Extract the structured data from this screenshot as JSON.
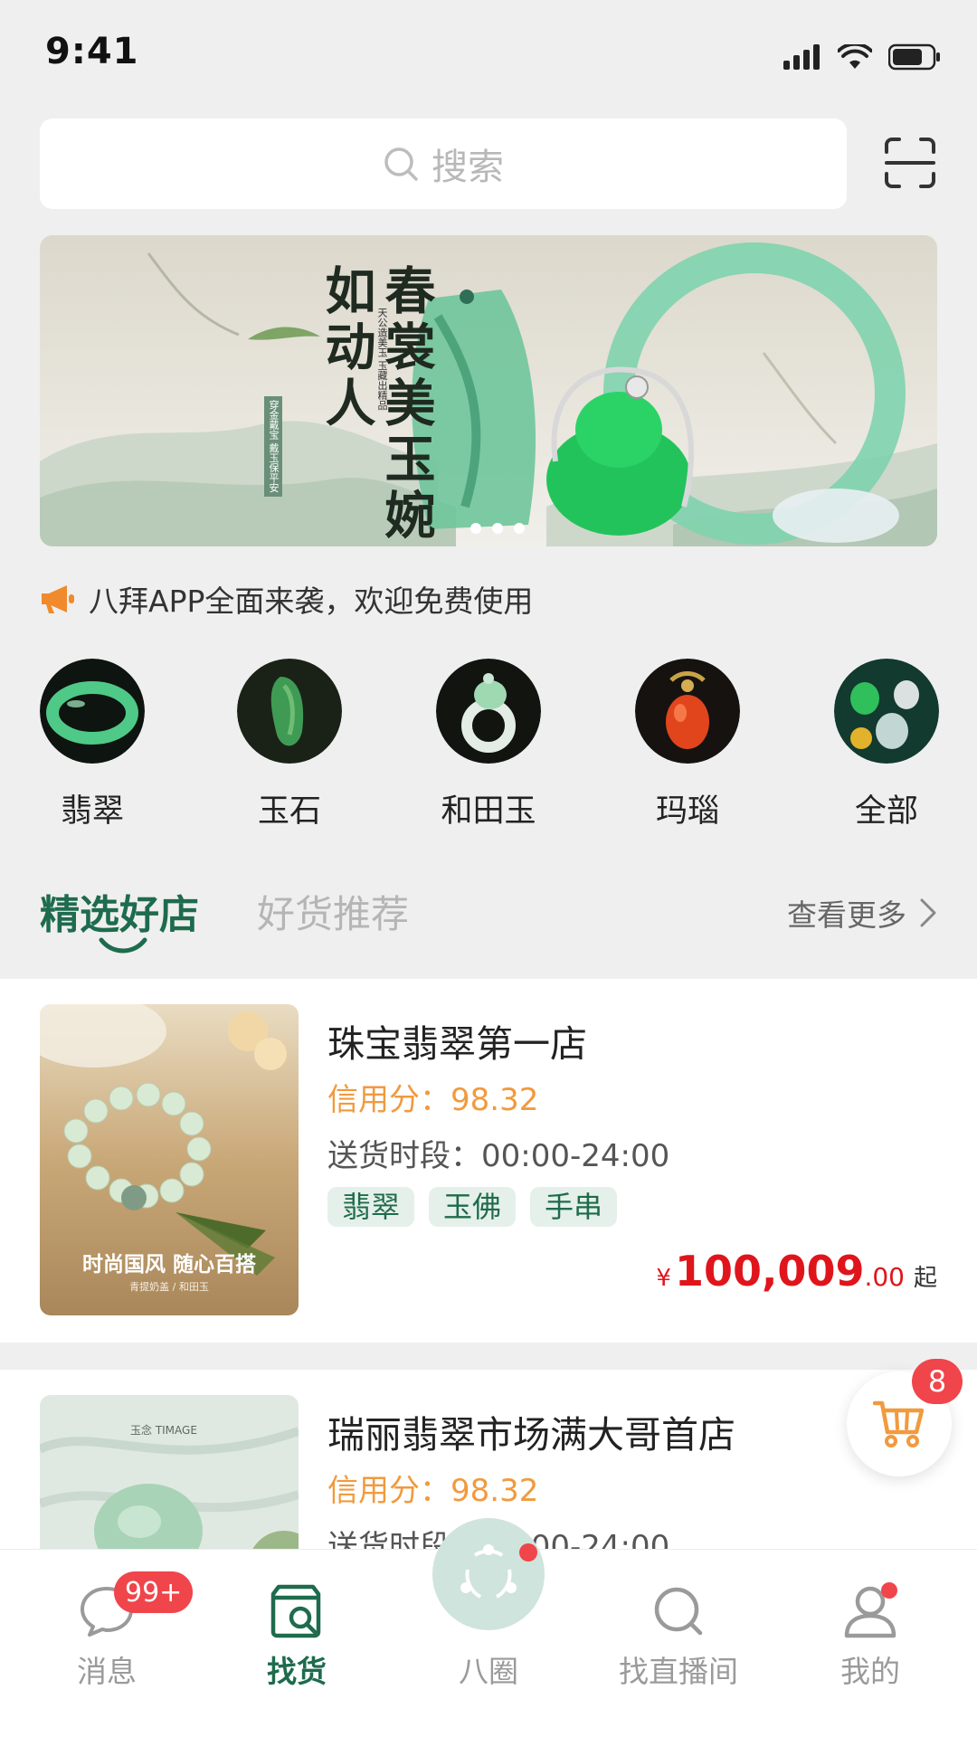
{
  "status_bar": {
    "time": "9:41"
  },
  "search": {
    "placeholder": "搜索"
  },
  "banner": {
    "title": "春裳美玉婉如动人",
    "subtitle": "天公造美玉 玉藏出精品",
    "tag": "穿金戴宝 戴玉保平安"
  },
  "notice": {
    "text": "八拜APP全面来袭，欢迎免费使用"
  },
  "categories": [
    {
      "label": "翡翠",
      "icon": "jade-bangle"
    },
    {
      "label": "玉石",
      "icon": "jade-pendant"
    },
    {
      "label": "和田玉",
      "icon": "hetian-jade"
    },
    {
      "label": "玛瑙",
      "icon": "agate"
    },
    {
      "label": "全部",
      "icon": "all"
    }
  ],
  "tabs": {
    "active": "精选好店",
    "inactive": "好货推荐",
    "see_more": "查看更多"
  },
  "shops": [
    {
      "name": "珠宝翡翠第一店",
      "credit": "信用分：98.32",
      "hours": "送货时段：00:00-24:00",
      "tags": [
        "翡翠",
        "玉佛",
        "手串"
      ],
      "thumb_caption": "时尚国风 随心百搭",
      "thumb_sub": "青提奶盖 / 和田玉",
      "price": {
        "currency": "¥",
        "integer": "100,009",
        "decimal": ".00",
        "suffix": "起"
      }
    },
    {
      "name": "瑞丽翡翠市场满大哥首店",
      "credit": "信用分：98.32",
      "hours": "送货时段：00:00-24:00",
      "thumb_brand": "玉念 TIMAGE"
    }
  ],
  "cart": {
    "badge": "8"
  },
  "bottom_nav": [
    {
      "label": "消息",
      "icon": "chat-icon",
      "badge": "99+"
    },
    {
      "label": "找货",
      "icon": "shop-search-icon",
      "active": true
    },
    {
      "label": "八圈",
      "icon": "circle-share-icon"
    },
    {
      "label": "找直播间",
      "icon": "search-icon"
    },
    {
      "label": "我的",
      "icon": "user-icon"
    }
  ],
  "colors": {
    "brand_green": "#1e6b4d",
    "price_red": "#e0151c",
    "credit_orange": "#f19a3e",
    "badge_red": "#f0454a"
  }
}
